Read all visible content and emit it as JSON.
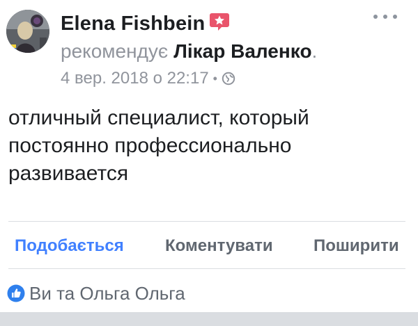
{
  "post": {
    "author": {
      "name": "Elena Fishbein",
      "avatar_icon": "profile-photo"
    },
    "recommendation": {
      "verb": "рекомендує",
      "target": "Лікар Валенко",
      "end_punct": ".",
      "badge_icon": "recommendation-star-icon"
    },
    "meta": {
      "timestamp": "4 вер. 2018 о 22:17",
      "separator": "•",
      "privacy_icon": "globe-icon"
    },
    "more_icon": "more-options-icon",
    "text": "отличный специалист, который постоянно профессионально развивается"
  },
  "actions": {
    "like_label": "Подобається",
    "comment_label": "Коментувати",
    "share_label": "Поширити"
  },
  "reactions": {
    "icon": "like-reaction-icon",
    "summary": "Ви та Ольга Ольга"
  },
  "colors": {
    "accent": "#4080ff",
    "badge": "#e9546b",
    "muted": "#90949c",
    "text": "#1c1e21",
    "action": "#606770",
    "divider": "#dadde1"
  }
}
